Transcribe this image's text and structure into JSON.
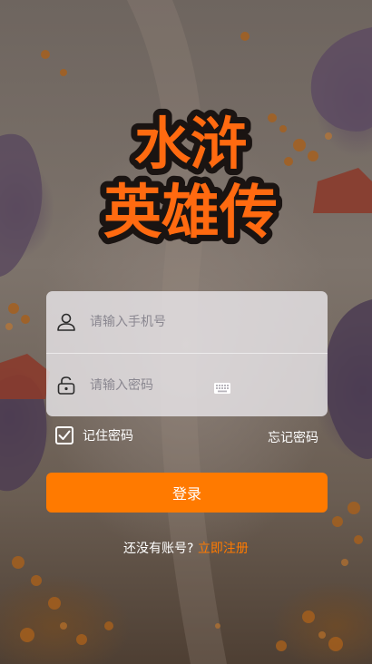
{
  "logo": {
    "line1": "水浒",
    "line2": "英雄传"
  },
  "form": {
    "phone": {
      "placeholder": "请输入手机号",
      "value": ""
    },
    "password": {
      "placeholder": "请输入密码",
      "value": ""
    }
  },
  "options": {
    "remember_label": "记住密码",
    "remember_checked": true,
    "forgot_label": "忘记密码"
  },
  "login_button": {
    "label": "登录"
  },
  "register": {
    "prompt": "还没有账号?",
    "link_label": "立即注册"
  },
  "colors": {
    "accent": "#ff7a00",
    "logo_fill": "#ff6a10",
    "logo_outline": "#1a1412"
  },
  "icons": {
    "phone_field": "user-icon",
    "password_field": "lock-icon",
    "keyboard": "keyboard-icon",
    "checkbox": "checkmark-icon"
  }
}
